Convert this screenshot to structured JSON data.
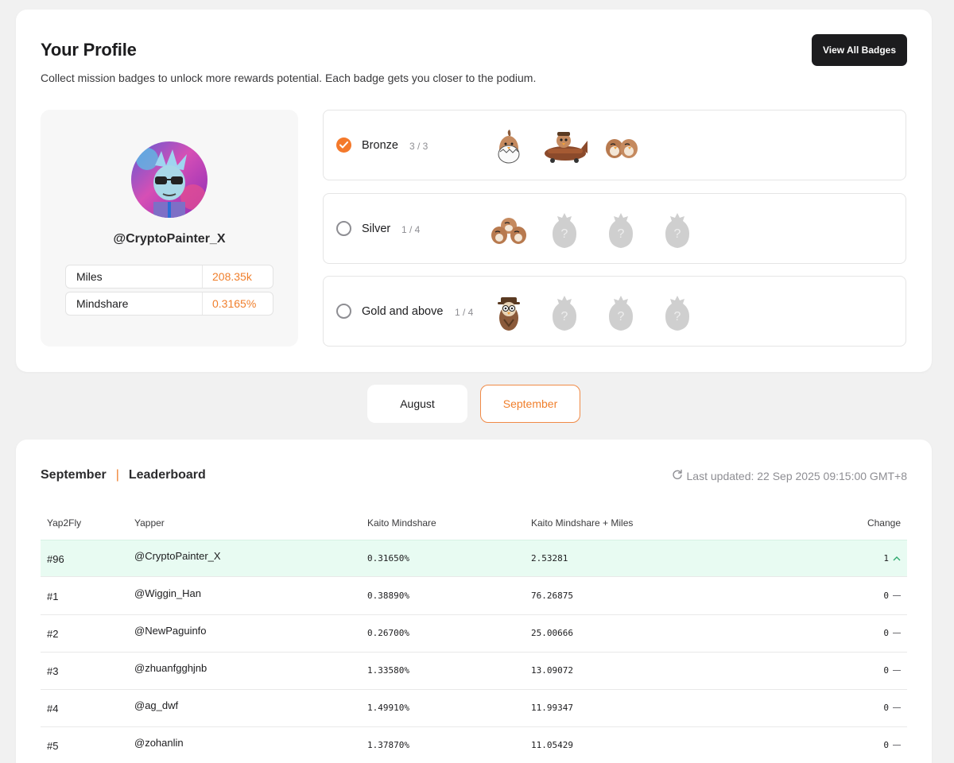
{
  "profile": {
    "title": "Your Profile",
    "subtitle": "Collect mission badges to unlock more rewards potential. Each badge gets you closer to the podium.",
    "view_all_label": "View All Badges",
    "handle": "@CryptoPainter_X",
    "stats": [
      {
        "label": "Miles",
        "value": "208.35k"
      },
      {
        "label": "Mindshare",
        "value": "0.3165%"
      }
    ]
  },
  "tiers": [
    {
      "name": "Bronze",
      "count": "3 / 3",
      "checked": true,
      "badges": [
        "egg-bird-badge",
        "plane-pilot-badge",
        "bird-duo-badge"
      ]
    },
    {
      "name": "Silver",
      "count": "1 / 4",
      "checked": false,
      "badges": [
        "bird-trio-badge",
        "locked-badge",
        "locked-badge",
        "locked-badge"
      ]
    },
    {
      "name": "Gold and above",
      "count": "1 / 4",
      "checked": false,
      "badges": [
        "detective-owl-badge",
        "locked-badge",
        "locked-badge",
        "locked-badge"
      ]
    }
  ],
  "months": {
    "august": "August",
    "september": "September",
    "active": "September"
  },
  "leaderboard": {
    "month": "September",
    "separator": "|",
    "title": "Leaderboard",
    "updated": "Last updated: 22 Sep 2025 09:15:00 GMT+8",
    "columns": [
      "Yap2Fly",
      "Yapper",
      "Kaito Mindshare",
      "Kaito Mindshare + Miles",
      "Change"
    ],
    "rows": [
      {
        "rank": "#96",
        "user": "@CryptoPainter_X",
        "mindshare": "0.31650%",
        "combined": "2.53281",
        "change": "1",
        "trend": "up",
        "highlight": true
      },
      {
        "rank": "#1",
        "user": "@Wiggin_Han",
        "mindshare": "0.38890%",
        "combined": "76.26875",
        "change": "0",
        "trend": "flat"
      },
      {
        "rank": "#2",
        "user": "@NewPaguinfo",
        "mindshare": "0.26700%",
        "combined": "25.00666",
        "change": "0",
        "trend": "flat"
      },
      {
        "rank": "#3",
        "user": "@zhuanfgghjnb",
        "mindshare": "1.33580%",
        "combined": "13.09072",
        "change": "0",
        "trend": "flat"
      },
      {
        "rank": "#4",
        "user": "@ag_dwf",
        "mindshare": "1.49910%",
        "combined": "11.99347",
        "change": "0",
        "trend": "flat"
      },
      {
        "rank": "#5",
        "user": "@zohanlin",
        "mindshare": "1.37870%",
        "combined": "11.05429",
        "change": "0",
        "trend": "flat"
      }
    ]
  },
  "colors": {
    "accent": "#f07f2c",
    "dark": "#1c1c1e",
    "highlight_row": "#e8fbf2"
  }
}
